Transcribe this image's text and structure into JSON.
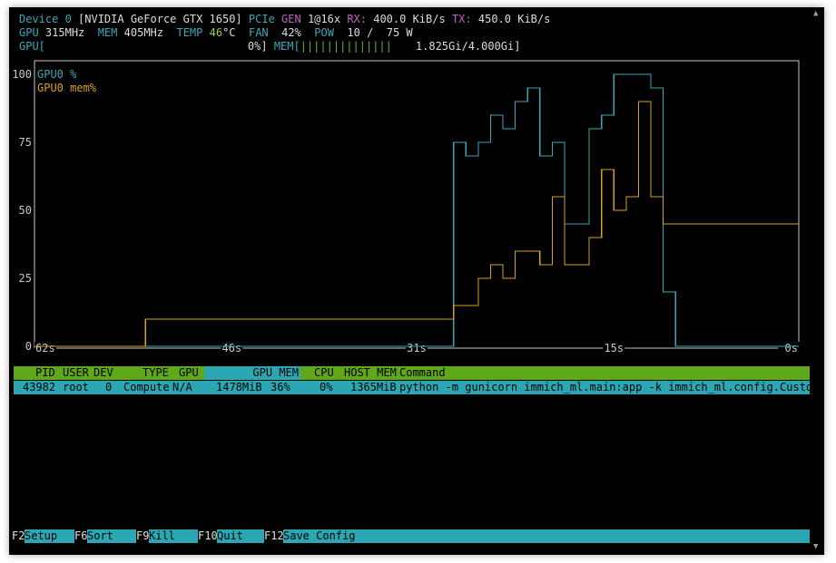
{
  "header": {
    "device_label": "Device 0",
    "device_name": "[NVIDIA GeForce GTX 1650]",
    "pcie_label": "PCIe",
    "gen_label": "GEN",
    "gen_value": "1@16x",
    "rx_label": "RX:",
    "rx_value": "400.0 KiB/s",
    "tx_label": "TX:",
    "tx_value": "450.0 KiB/s",
    "gpu_clock_label": "GPU",
    "gpu_clock_value": "315MHz",
    "mem_clock_label": "MEM",
    "mem_clock_value": "405MHz",
    "temp_label": "TEMP",
    "temp_value": "46",
    "temp_unit": "°C",
    "fan_label": "FAN",
    "fan_value": "42%",
    "pow_label": "POW",
    "pow_value": "10 /  75 W",
    "gpu_bar_label": "GPU[",
    "gpu_bar_value": "0%]",
    "mem_bar_label": "MEM[",
    "mem_bar_fill": "||||||||||||||",
    "mem_bar_value": "1.825Gi/4.000Gi]"
  },
  "graph": {
    "y_ticks": [
      "100",
      "75",
      "50",
      "25",
      "0"
    ],
    "x_ticks": [
      "62s",
      "46s",
      "31s",
      "15s",
      "0s"
    ],
    "legend_gpu": "GPU0 %",
    "legend_mem": "GPU0 mem%",
    "colors": {
      "gpu": "#3aa8b8",
      "mem": "#d9a21b",
      "frame": "#c8c8c8"
    }
  },
  "chart_data": {
    "type": "line",
    "x_label_ticks": [
      "62s",
      "46s",
      "31s",
      "15s",
      "0s"
    ],
    "ylim": [
      0,
      100
    ],
    "series": [
      {
        "name": "GPU0 %",
        "steps": [
          [
            62,
            0
          ],
          [
            28,
            75
          ],
          [
            27,
            70
          ],
          [
            26,
            75
          ],
          [
            25,
            85
          ],
          [
            24,
            80
          ],
          [
            23,
            90
          ],
          [
            22,
            95
          ],
          [
            21,
            70
          ],
          [
            20,
            75
          ],
          [
            19,
            45
          ],
          [
            17,
            80
          ],
          [
            16,
            85
          ],
          [
            15,
            100
          ],
          [
            12,
            95
          ],
          [
            11,
            20
          ],
          [
            10,
            0
          ],
          [
            0,
            0
          ]
        ]
      },
      {
        "name": "GPU0 mem%",
        "steps": [
          [
            62,
            0
          ],
          [
            53,
            10
          ],
          [
            28,
            15
          ],
          [
            27,
            15
          ],
          [
            26,
            25
          ],
          [
            25,
            30
          ],
          [
            24,
            25
          ],
          [
            23,
            35
          ],
          [
            21,
            30
          ],
          [
            20,
            55
          ],
          [
            19,
            30
          ],
          [
            17,
            40
          ],
          [
            16,
            65
          ],
          [
            15,
            50
          ],
          [
            14,
            55
          ],
          [
            13,
            90
          ],
          [
            12,
            55
          ],
          [
            11,
            45
          ],
          [
            0,
            45
          ]
        ]
      }
    ]
  },
  "process_table": {
    "headers": [
      "PID",
      "USER",
      "DEV",
      "TYPE",
      "GPU",
      "GPU MEM",
      "CPU",
      "HOST MEM",
      "Command"
    ],
    "rows": [
      {
        "pid": "43982",
        "user": "root",
        "dev": "0",
        "type": "Compute",
        "gpu": "N/A",
        "gpu_mem": "1478MiB",
        "gpu_mem_pct": "36%",
        "cpu": "0%",
        "host_mem": "1365MiB",
        "command": "python -m gunicorn immich_ml.main:app -k immich_ml.config.CustomUvi"
      }
    ]
  },
  "function_keys": [
    {
      "key": "F2",
      "action": "Setup"
    },
    {
      "key": "F6",
      "action": "Sort"
    },
    {
      "key": "F9",
      "action": "Kill"
    },
    {
      "key": "F10",
      "action": "Quit"
    },
    {
      "key": "F12",
      "action": "Save Config"
    }
  ]
}
